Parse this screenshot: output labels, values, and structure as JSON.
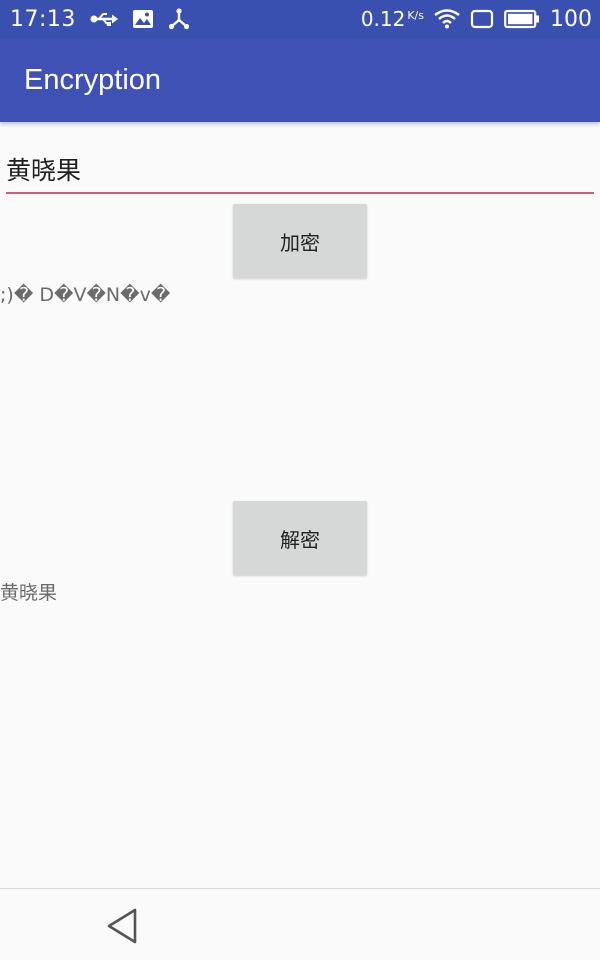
{
  "status_bar": {
    "time": "17:13",
    "network_speed": "0.12",
    "network_speed_unit": "K/s",
    "battery_percent": "100",
    "left_icons": [
      "usb-icon",
      "image-icon",
      "usb-debug-icon"
    ],
    "right_icons": [
      "wifi-icon",
      "no-sim-icon",
      "battery-icon"
    ]
  },
  "app_bar": {
    "title": "Encryption",
    "color": "#3f51b5"
  },
  "input": {
    "value": "黄晓果",
    "underline_color": "#d35a7a"
  },
  "encrypt_button": {
    "label": "加密"
  },
  "encrypted_output": {
    "text": ";)� D�V�N�v�"
  },
  "decrypt_button": {
    "label": "解密"
  },
  "decrypted_output": {
    "text": "黄晓果"
  },
  "nav_bar": {
    "icons": [
      "back-icon"
    ]
  }
}
